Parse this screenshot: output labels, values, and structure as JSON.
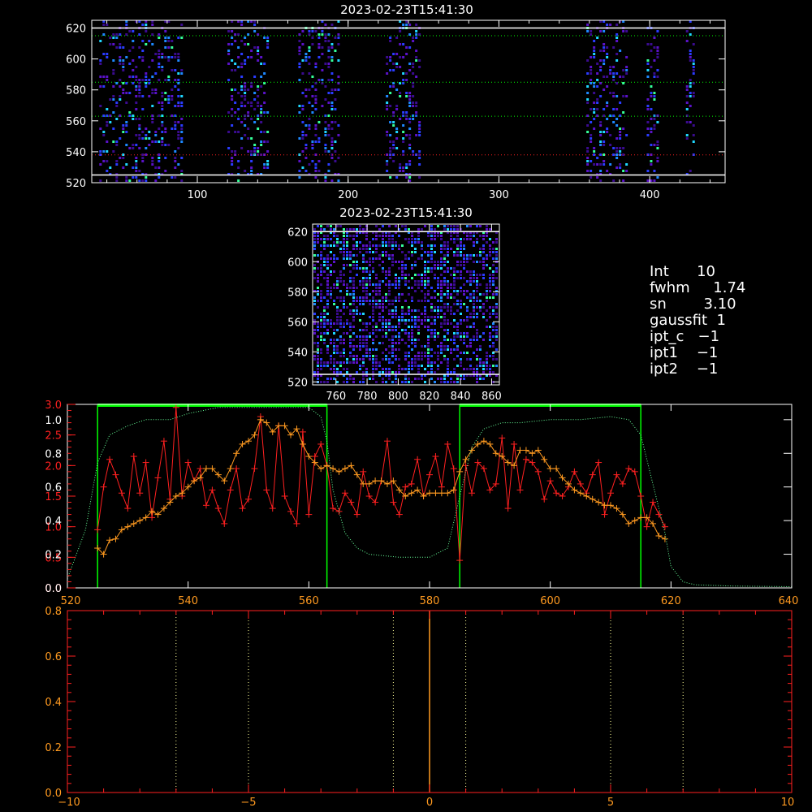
{
  "colors": {
    "background": "#000000",
    "axis": "#ffffff",
    "red": "#ff2020",
    "orange": "#ff9a20",
    "green": "#00ff00",
    "dotted_green": "#66ff99",
    "dotted_cream": "#ffff99",
    "dotted_red": "#ff3030",
    "heat": [
      "#3a0b8f",
      "#5a12c8",
      "#2a3cff",
      "#1e88ff",
      "#20d8ff",
      "#35ff9a"
    ]
  },
  "chart_data": [
    {
      "type": "heatmap",
      "id": "top",
      "title": "2023-02-23T15:41:30",
      "xlim": [
        30,
        450
      ],
      "ylim": [
        520,
        625
      ],
      "x_ticks": [
        100,
        200,
        300,
        400
      ],
      "y_ticks": [
        520,
        540,
        560,
        580,
        600,
        620
      ],
      "bands": [
        [
          35,
          90
        ],
        [
          120,
          147
        ],
        [
          167,
          195
        ],
        [
          225,
          248
        ],
        [
          358,
          385
        ],
        [
          398,
          406
        ],
        [
          424,
          429
        ]
      ],
      "hlines": [
        {
          "y": 620,
          "style": "solid",
          "color": "white"
        },
        {
          "y": 525,
          "style": "solid",
          "color": "white"
        },
        {
          "y": 615,
          "style": "dotted",
          "color": "green"
        },
        {
          "y": 585,
          "style": "dotted",
          "color": "green"
        },
        {
          "y": 563,
          "style": "dotted",
          "color": "green"
        },
        {
          "y": 538,
          "style": "dotted",
          "color": "red"
        }
      ]
    },
    {
      "type": "heatmap",
      "id": "zoom",
      "title": "2023-02-23T15:41:30",
      "xlim": [
        745,
        865
      ],
      "ylim": [
        518,
        625
      ],
      "x_ticks": [
        760,
        780,
        800,
        820,
        840,
        860
      ],
      "y_ticks": [
        520,
        540,
        560,
        580,
        600,
        620
      ],
      "hlines": [
        {
          "y": 620,
          "style": "solid",
          "color": "white"
        },
        {
          "y": 525,
          "style": "solid",
          "color": "white"
        }
      ]
    },
    {
      "type": "line",
      "id": "profile",
      "xlim": [
        520,
        640
      ],
      "ylim": [
        0,
        3.0
      ],
      "x_ticks": [
        520,
        540,
        560,
        580,
        600,
        620,
        640
      ],
      "y_ticks_red": [
        "0.0",
        "0.5",
        "1.0",
        "1.5",
        "2.0",
        "2.5",
        "3.0"
      ],
      "y_ticks_white": [
        "0.0",
        "0.2",
        "0.4",
        "0.6",
        "0.8",
        "1.0"
      ],
      "green_boxes": [
        [
          525,
          563
        ],
        [
          585,
          615
        ]
      ],
      "series": [
        {
          "color": "red",
          "x": [
            525,
            526,
            527,
            528,
            529,
            530,
            531,
            532,
            533,
            534,
            535,
            536,
            537,
            538,
            539,
            540,
            541,
            542,
            543,
            544,
            545,
            546,
            547,
            548,
            549,
            550,
            551,
            552,
            553,
            554,
            555,
            556,
            557,
            558,
            559,
            560,
            561,
            562,
            563,
            564,
            565,
            566,
            567,
            568,
            569,
            570,
            571,
            572,
            573,
            574,
            575,
            576,
            577,
            578,
            579,
            580,
            581,
            582,
            583,
            584,
            585,
            586,
            587,
            588,
            589,
            590,
            591,
            592,
            593,
            594,
            595,
            596,
            597,
            598,
            599,
            600,
            601,
            602,
            603,
            604,
            605,
            606,
            607,
            608,
            609,
            610,
            611,
            612,
            613,
            614,
            615,
            616,
            617,
            618,
            619
          ],
          "y": [
            0.95,
            1.65,
            2.1,
            1.85,
            1.55,
            1.3,
            2.15,
            1.55,
            2.05,
            1.15,
            1.8,
            2.4,
            1.45,
            2.95,
            1.5,
            2.05,
            1.75,
            1.95,
            1.35,
            1.6,
            1.3,
            1.05,
            1.6,
            1.95,
            1.3,
            1.45,
            1.95,
            2.8,
            1.6,
            1.3,
            2.65,
            1.5,
            1.25,
            1.05,
            2.55,
            1.2,
            2.15,
            2.35,
            2.0,
            1.3,
            1.25,
            1.55,
            1.4,
            1.2,
            1.9,
            1.5,
            1.4,
            1.75,
            2.4,
            1.4,
            1.2,
            1.65,
            1.7,
            2.1,
            1.5,
            1.85,
            2.15,
            1.65,
            2.35,
            1.95,
            0.45,
            2.0,
            1.55,
            2.05,
            1.95,
            1.6,
            1.7,
            2.45,
            1.3,
            2.35,
            1.6,
            2.1,
            2.05,
            1.9,
            1.45,
            1.75,
            1.55,
            1.5,
            1.65,
            1.9,
            1.7,
            1.55,
            1.85,
            2.05,
            1.2,
            1.55,
            1.85,
            1.7,
            1.95,
            1.9,
            1.5,
            1.0,
            1.4,
            1.2,
            1.0
          ]
        },
        {
          "color": "orange",
          "x": [
            525,
            526,
            527,
            528,
            529,
            530,
            531,
            532,
            533,
            534,
            535,
            536,
            537,
            538,
            539,
            540,
            541,
            542,
            543,
            544,
            545,
            546,
            547,
            548,
            549,
            550,
            551,
            552,
            553,
            554,
            555,
            556,
            557,
            558,
            559,
            560,
            561,
            562,
            563,
            564,
            565,
            566,
            567,
            568,
            569,
            570,
            571,
            572,
            573,
            574,
            575,
            576,
            577,
            578,
            579,
            580,
            581,
            582,
            583,
            584,
            585,
            586,
            587,
            588,
            589,
            590,
            591,
            592,
            593,
            594,
            595,
            596,
            597,
            598,
            599,
            600,
            601,
            602,
            603,
            604,
            605,
            606,
            607,
            608,
            609,
            610,
            611,
            612,
            613,
            614,
            615,
            616,
            617,
            618,
            619
          ],
          "y": [
            0.65,
            0.55,
            0.78,
            0.8,
            0.95,
            1.0,
            1.05,
            1.1,
            1.15,
            1.25,
            1.2,
            1.3,
            1.4,
            1.5,
            1.55,
            1.65,
            1.75,
            1.8,
            1.95,
            1.95,
            1.85,
            1.75,
            1.95,
            2.2,
            2.35,
            2.4,
            2.5,
            2.75,
            2.7,
            2.55,
            2.65,
            2.65,
            2.5,
            2.6,
            2.35,
            2.15,
            2.05,
            1.95,
            2.0,
            1.95,
            1.9,
            1.95,
            2.0,
            1.85,
            1.7,
            1.7,
            1.75,
            1.75,
            1.7,
            1.75,
            1.6,
            1.5,
            1.55,
            1.6,
            1.5,
            1.55,
            1.55,
            1.55,
            1.55,
            1.6,
            1.9,
            2.1,
            2.25,
            2.35,
            2.4,
            2.35,
            2.2,
            2.15,
            2.05,
            2.0,
            2.25,
            2.25,
            2.2,
            2.25,
            2.1,
            1.95,
            1.95,
            1.8,
            1.7,
            1.6,
            1.55,
            1.5,
            1.45,
            1.4,
            1.35,
            1.35,
            1.3,
            1.2,
            1.05,
            1.1,
            1.15,
            1.15,
            1.05,
            0.85,
            0.8
          ]
        },
        {
          "color": "dotted_green",
          "style": "dotted",
          "x": [
            520,
            523,
            525,
            527,
            530,
            533,
            537,
            540,
            545,
            550,
            555,
            560,
            562,
            563,
            564,
            566,
            568,
            570,
            575,
            580,
            583,
            585,
            587,
            589,
            592,
            595,
            600,
            605,
            610,
            613,
            615,
            617,
            619,
            620,
            622,
            624,
            630,
            640
          ],
          "y": [
            0.15,
            0.95,
            2.05,
            2.5,
            2.65,
            2.75,
            2.75,
            2.85,
            2.95,
            2.95,
            2.95,
            2.95,
            2.8,
            2.4,
            1.6,
            0.9,
            0.65,
            0.55,
            0.5,
            0.5,
            0.65,
            1.5,
            2.3,
            2.6,
            2.7,
            2.7,
            2.75,
            2.75,
            2.8,
            2.75,
            2.5,
            1.7,
            0.9,
            0.35,
            0.1,
            0.05,
            0.03,
            0.02
          ]
        }
      ]
    },
    {
      "type": "line",
      "id": "bottom",
      "xlim": [
        -10,
        10
      ],
      "ylim": [
        0,
        0.8
      ],
      "x_ticks": [
        "−10",
        "−5",
        "0",
        "5",
        "10"
      ],
      "y_ticks": [
        "0.0",
        "0.2",
        "0.4",
        "0.6",
        "0.8"
      ],
      "vlines": [
        {
          "x": -7,
          "style": "dotted",
          "color": "dotted_cream"
        },
        {
          "x": -5,
          "style": "dotted",
          "color": "dotted_cream"
        },
        {
          "x": -1,
          "style": "dotted",
          "color": "dotted_cream"
        },
        {
          "x": 0,
          "style": "solid",
          "color": "orange"
        },
        {
          "x": 1,
          "style": "dotted",
          "color": "dotted_cream"
        },
        {
          "x": 5,
          "style": "dotted",
          "color": "dotted_cream"
        },
        {
          "x": 7,
          "style": "dotted",
          "color": "dotted_cream"
        }
      ]
    }
  ],
  "info": {
    "int": "Int      10",
    "fwhm": "fwhm     1.74",
    "sn": "sn        3.10",
    "gaussfit": "gaussfit  1",
    "ipt_c": "ipt_c   −1",
    "ipt1": "ipt1    −1",
    "ipt2": "ipt2    −1"
  }
}
